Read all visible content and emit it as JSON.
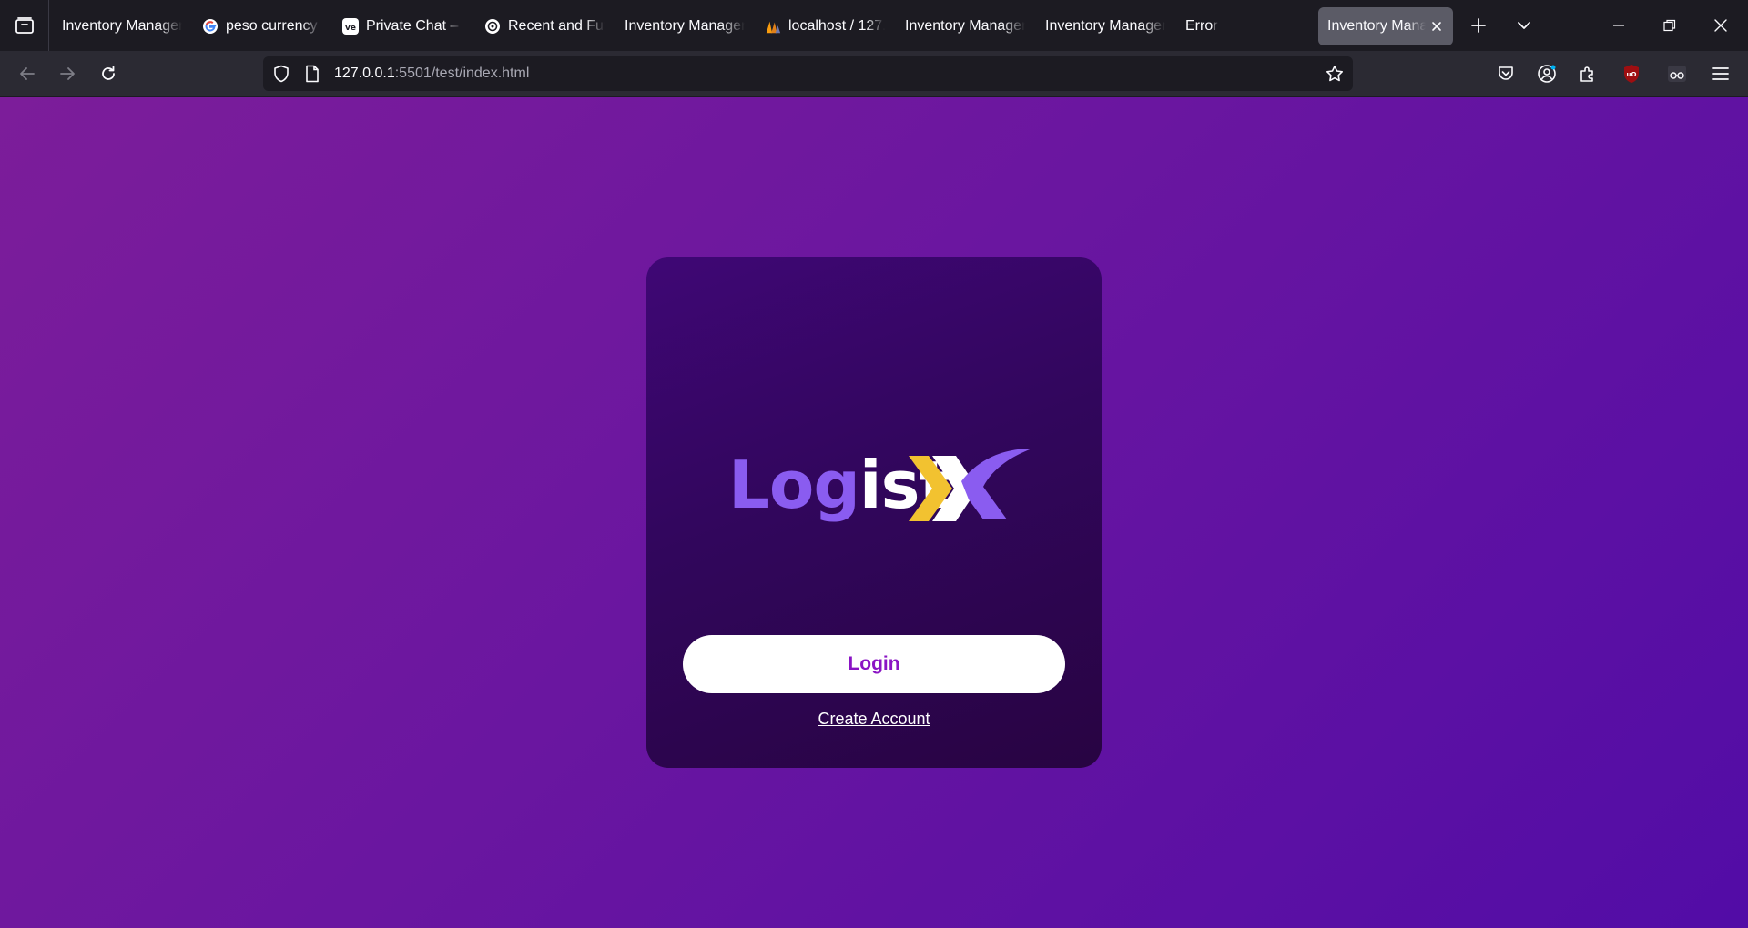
{
  "browser": {
    "tabs": [
      {
        "title": "Inventory Managen",
        "icon": "none"
      },
      {
        "title": "peso currency -",
        "icon": "google-icon"
      },
      {
        "title": "Private Chat – v",
        "icon": "chat-app-icon"
      },
      {
        "title": "Recent and Futu",
        "icon": "openai-icon"
      },
      {
        "title": "Inventory Managen",
        "icon": "none"
      },
      {
        "title": "localhost / 127.",
        "icon": "phpmyadmin-icon"
      },
      {
        "title": "Inventory Managen",
        "icon": "none"
      },
      {
        "title": "Inventory Managen",
        "icon": "none"
      },
      {
        "title": "Error",
        "icon": "none"
      }
    ],
    "active_tab": {
      "title": "Inventory Manag",
      "icon": "none"
    },
    "url_host": "127.0.0.1",
    "url_rest": ":5501/test/index.html",
    "colors": {
      "tabstrip": "#1c1b22",
      "navbar": "#2b2a33",
      "active_tab": "#5b5b66"
    }
  },
  "page": {
    "logo": {
      "part1": "Log",
      "part2": "i",
      "part3": "st"
    },
    "login_label": "Login",
    "create_account_label": "Create Account",
    "colors": {
      "background_start": "#7c1d9a",
      "background_end": "#520ca6",
      "card": "#350660",
      "accent_purple": "#8a5cf0",
      "chevron_yellow": "#f2c230",
      "button_text": "#8a14c4"
    }
  }
}
